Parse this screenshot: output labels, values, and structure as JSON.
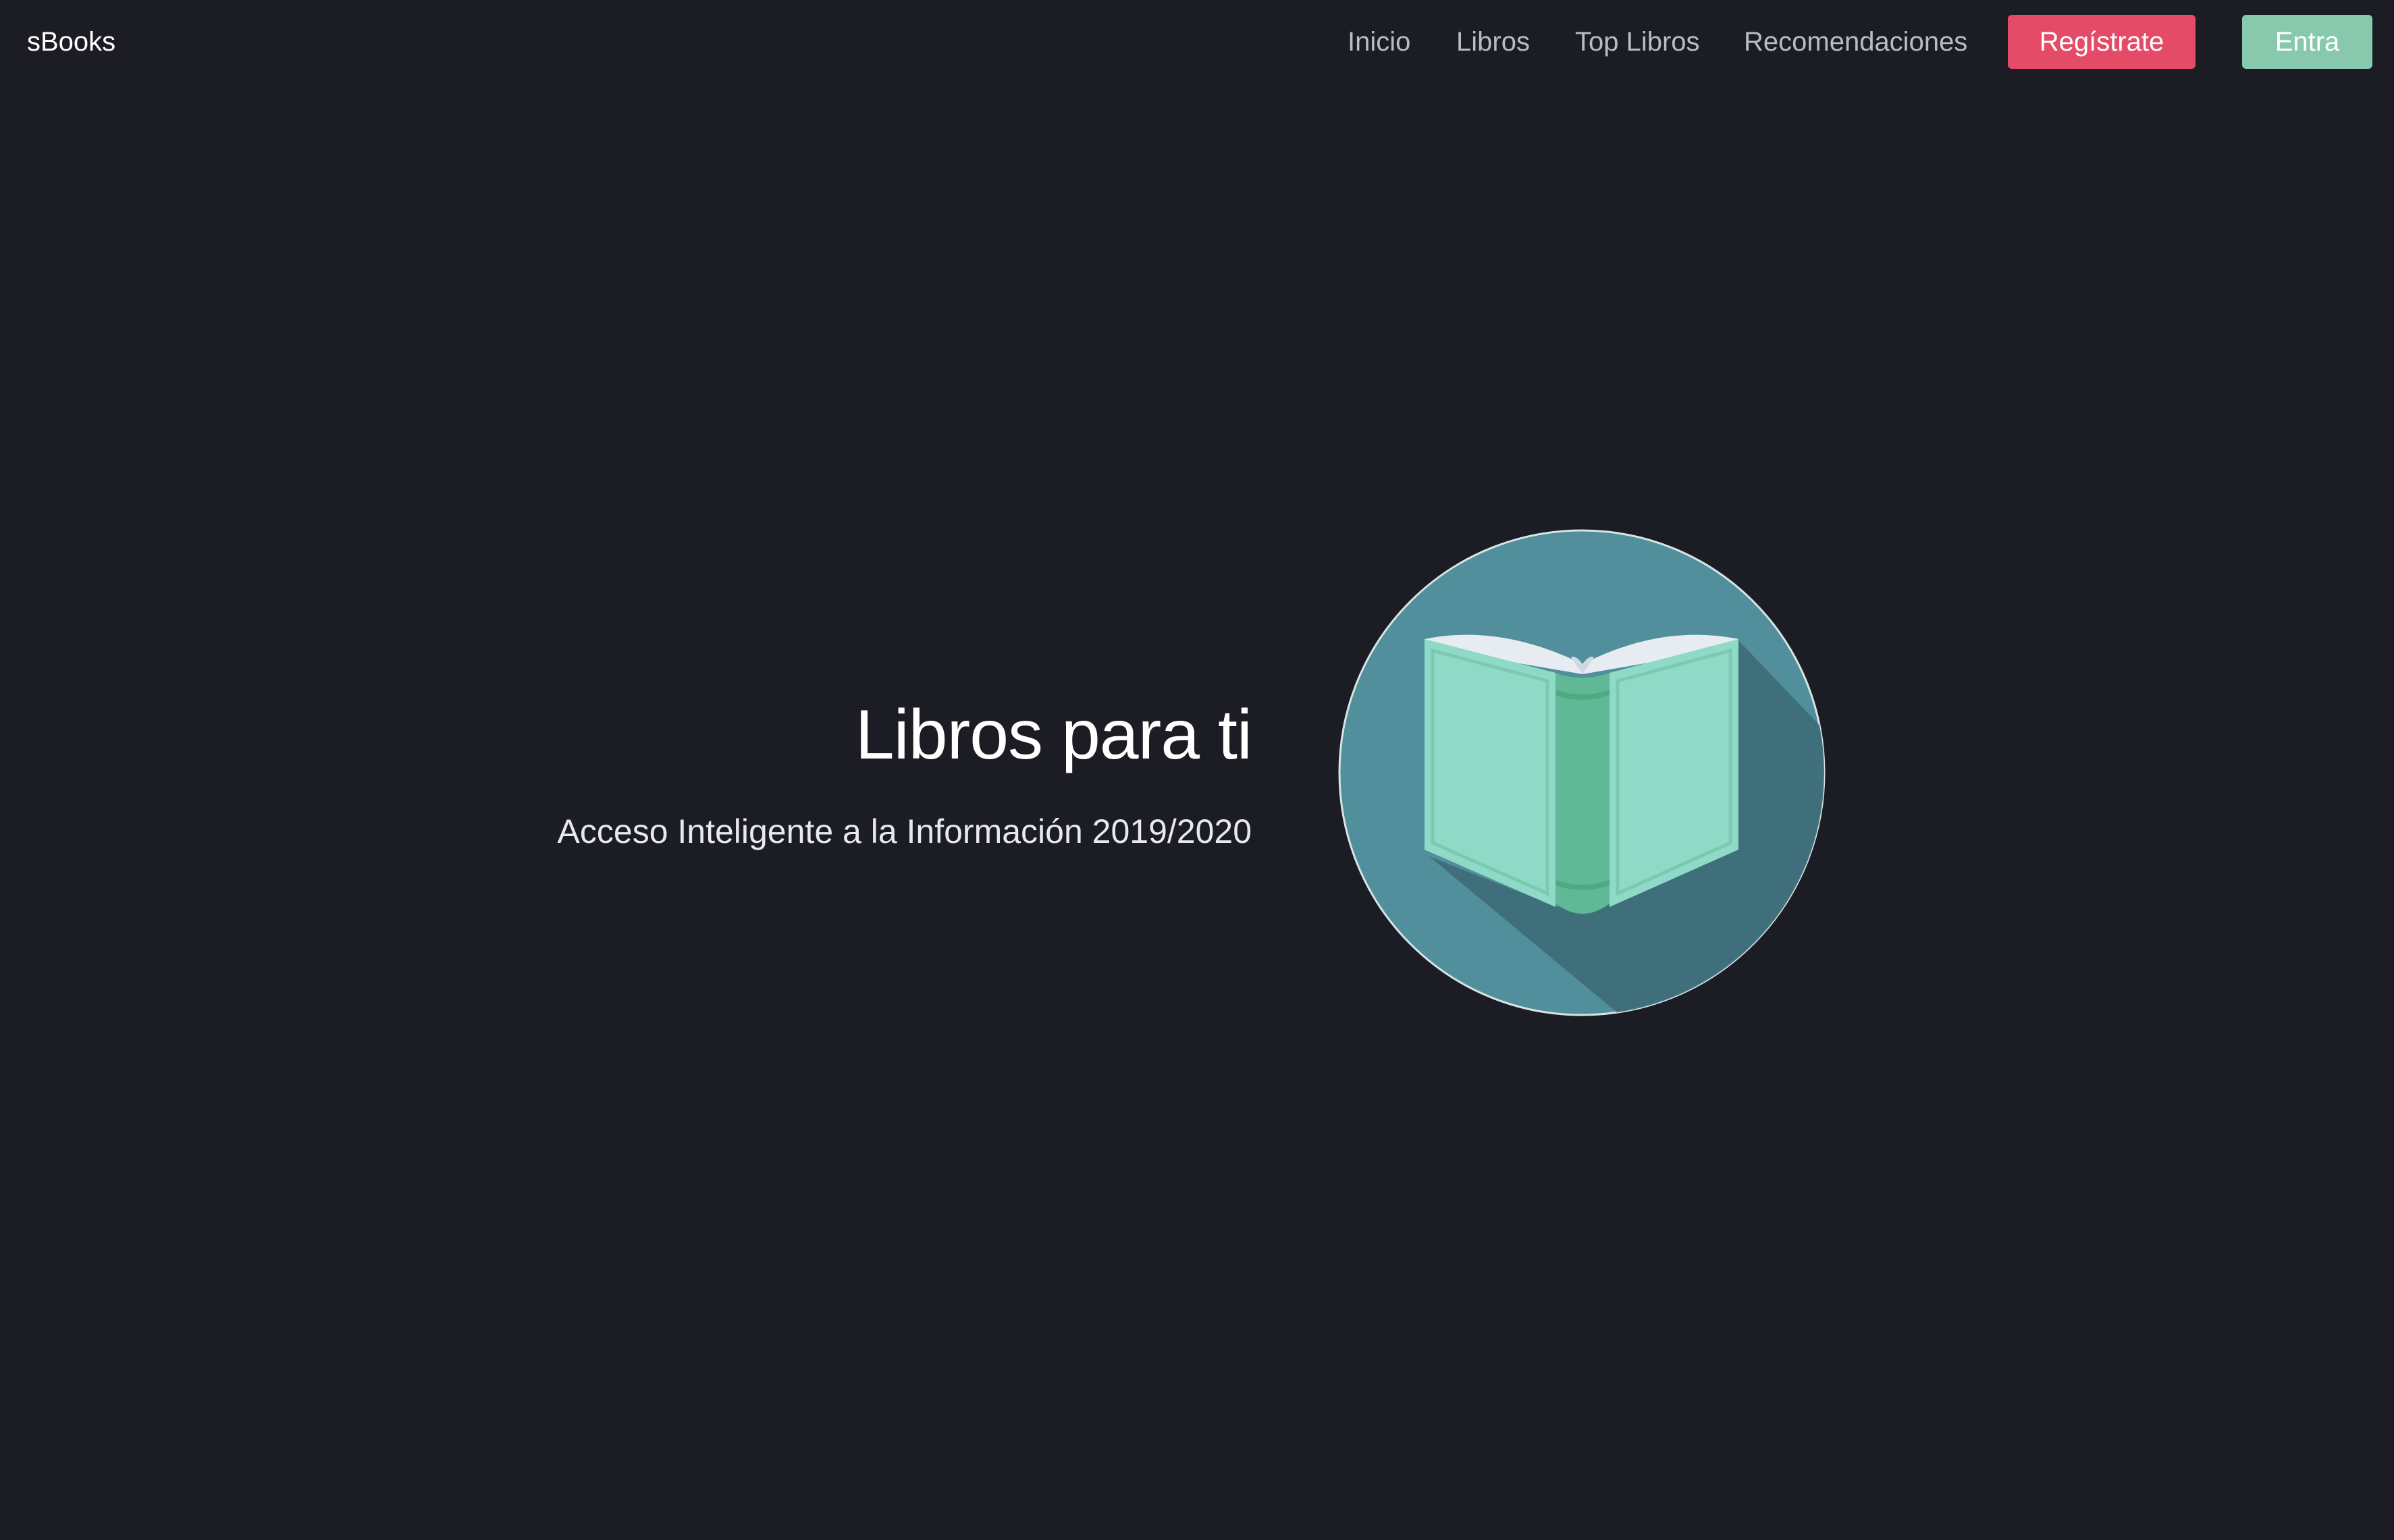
{
  "navbar": {
    "brand": "sBooks",
    "links": [
      "Inicio",
      "Libros",
      "Top Libros",
      "Recomendaciones"
    ],
    "register_label": "Regístrate",
    "login_label": "Entra"
  },
  "hero": {
    "title": "Libros para ti",
    "subtitle": "Acceso Inteligente a la Información 2019/2020",
    "logo_icon": "open-book-icon"
  },
  "colors": {
    "background": "#1b1c24",
    "register_button": "#e34b66",
    "login_button": "#88c9ad",
    "logo_circle": "#508f9b",
    "book_cover": "#8fdac6",
    "book_spine": "#5fb996"
  }
}
